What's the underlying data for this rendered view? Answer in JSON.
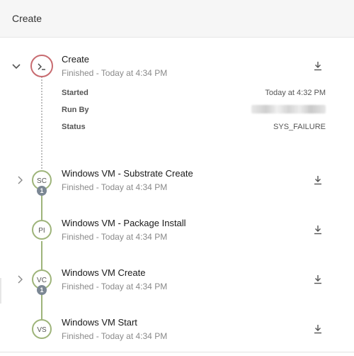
{
  "header": {
    "title": "Create"
  },
  "main_step": {
    "title": "Create",
    "subtitle": "Finished - Today at 4:34 PM",
    "details": {
      "started_label": "Started",
      "started_value": "Today at 4:32 PM",
      "run_by_label": "Run By",
      "status_label": "Status",
      "status_value": "SYS_FAILURE"
    }
  },
  "steps": [
    {
      "abbr": "SC",
      "title": "Windows VM - Substrate Create",
      "subtitle": "Finished - Today at 4:34 PM",
      "badge": "1"
    },
    {
      "abbr": "PI",
      "title": "Windows VM - Package Install",
      "subtitle": "Finished - Today at 4:34 PM"
    },
    {
      "abbr": "VC",
      "title": "Windows VM Create",
      "subtitle": "Finished - Today at 4:34 PM",
      "badge": "1"
    },
    {
      "abbr": "VS",
      "title": "Windows VM Start",
      "subtitle": "Finished - Today at 4:34 PM"
    }
  ],
  "icons": {
    "main": "terminal-icon",
    "expand": "chevron-down-icon",
    "collapsed": "chevron-right-icon",
    "download": "download-icon"
  },
  "colors": {
    "success": "#9eb47a",
    "failure": "#c86b70",
    "badge": "#7b8794"
  }
}
